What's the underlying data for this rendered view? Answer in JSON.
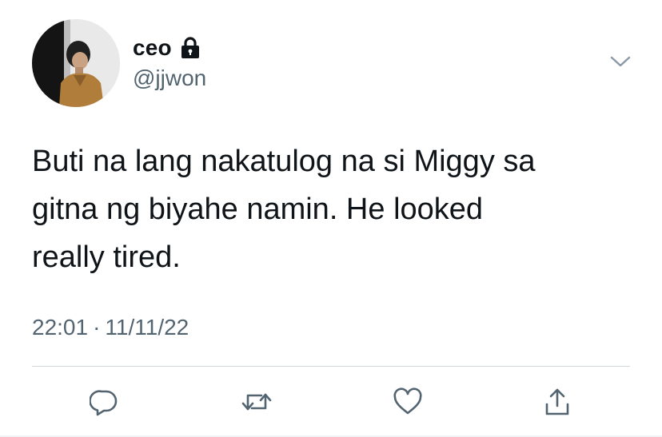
{
  "user": {
    "display_name": "ceo",
    "handle": "@jjwon",
    "avatar_icon": "profile-photo",
    "protected_icon": "lock-icon"
  },
  "tweet": {
    "text": "Buti na lang nakatulog na si Miggy sa\ngitna ng biyahe namin. He looked\nreally tired.",
    "time": "22:01",
    "separator": "·",
    "date": "11/11/22"
  },
  "actions": [
    {
      "name": "reply",
      "icon": "speech-bubble-icon"
    },
    {
      "name": "retweet",
      "icon": "retweet-icon"
    },
    {
      "name": "like",
      "icon": "heart-icon"
    },
    {
      "name": "share",
      "icon": "share-icon"
    }
  ],
  "colors": {
    "text": "#0f1419",
    "secondary": "#536471",
    "divider": "#cfd9de"
  }
}
